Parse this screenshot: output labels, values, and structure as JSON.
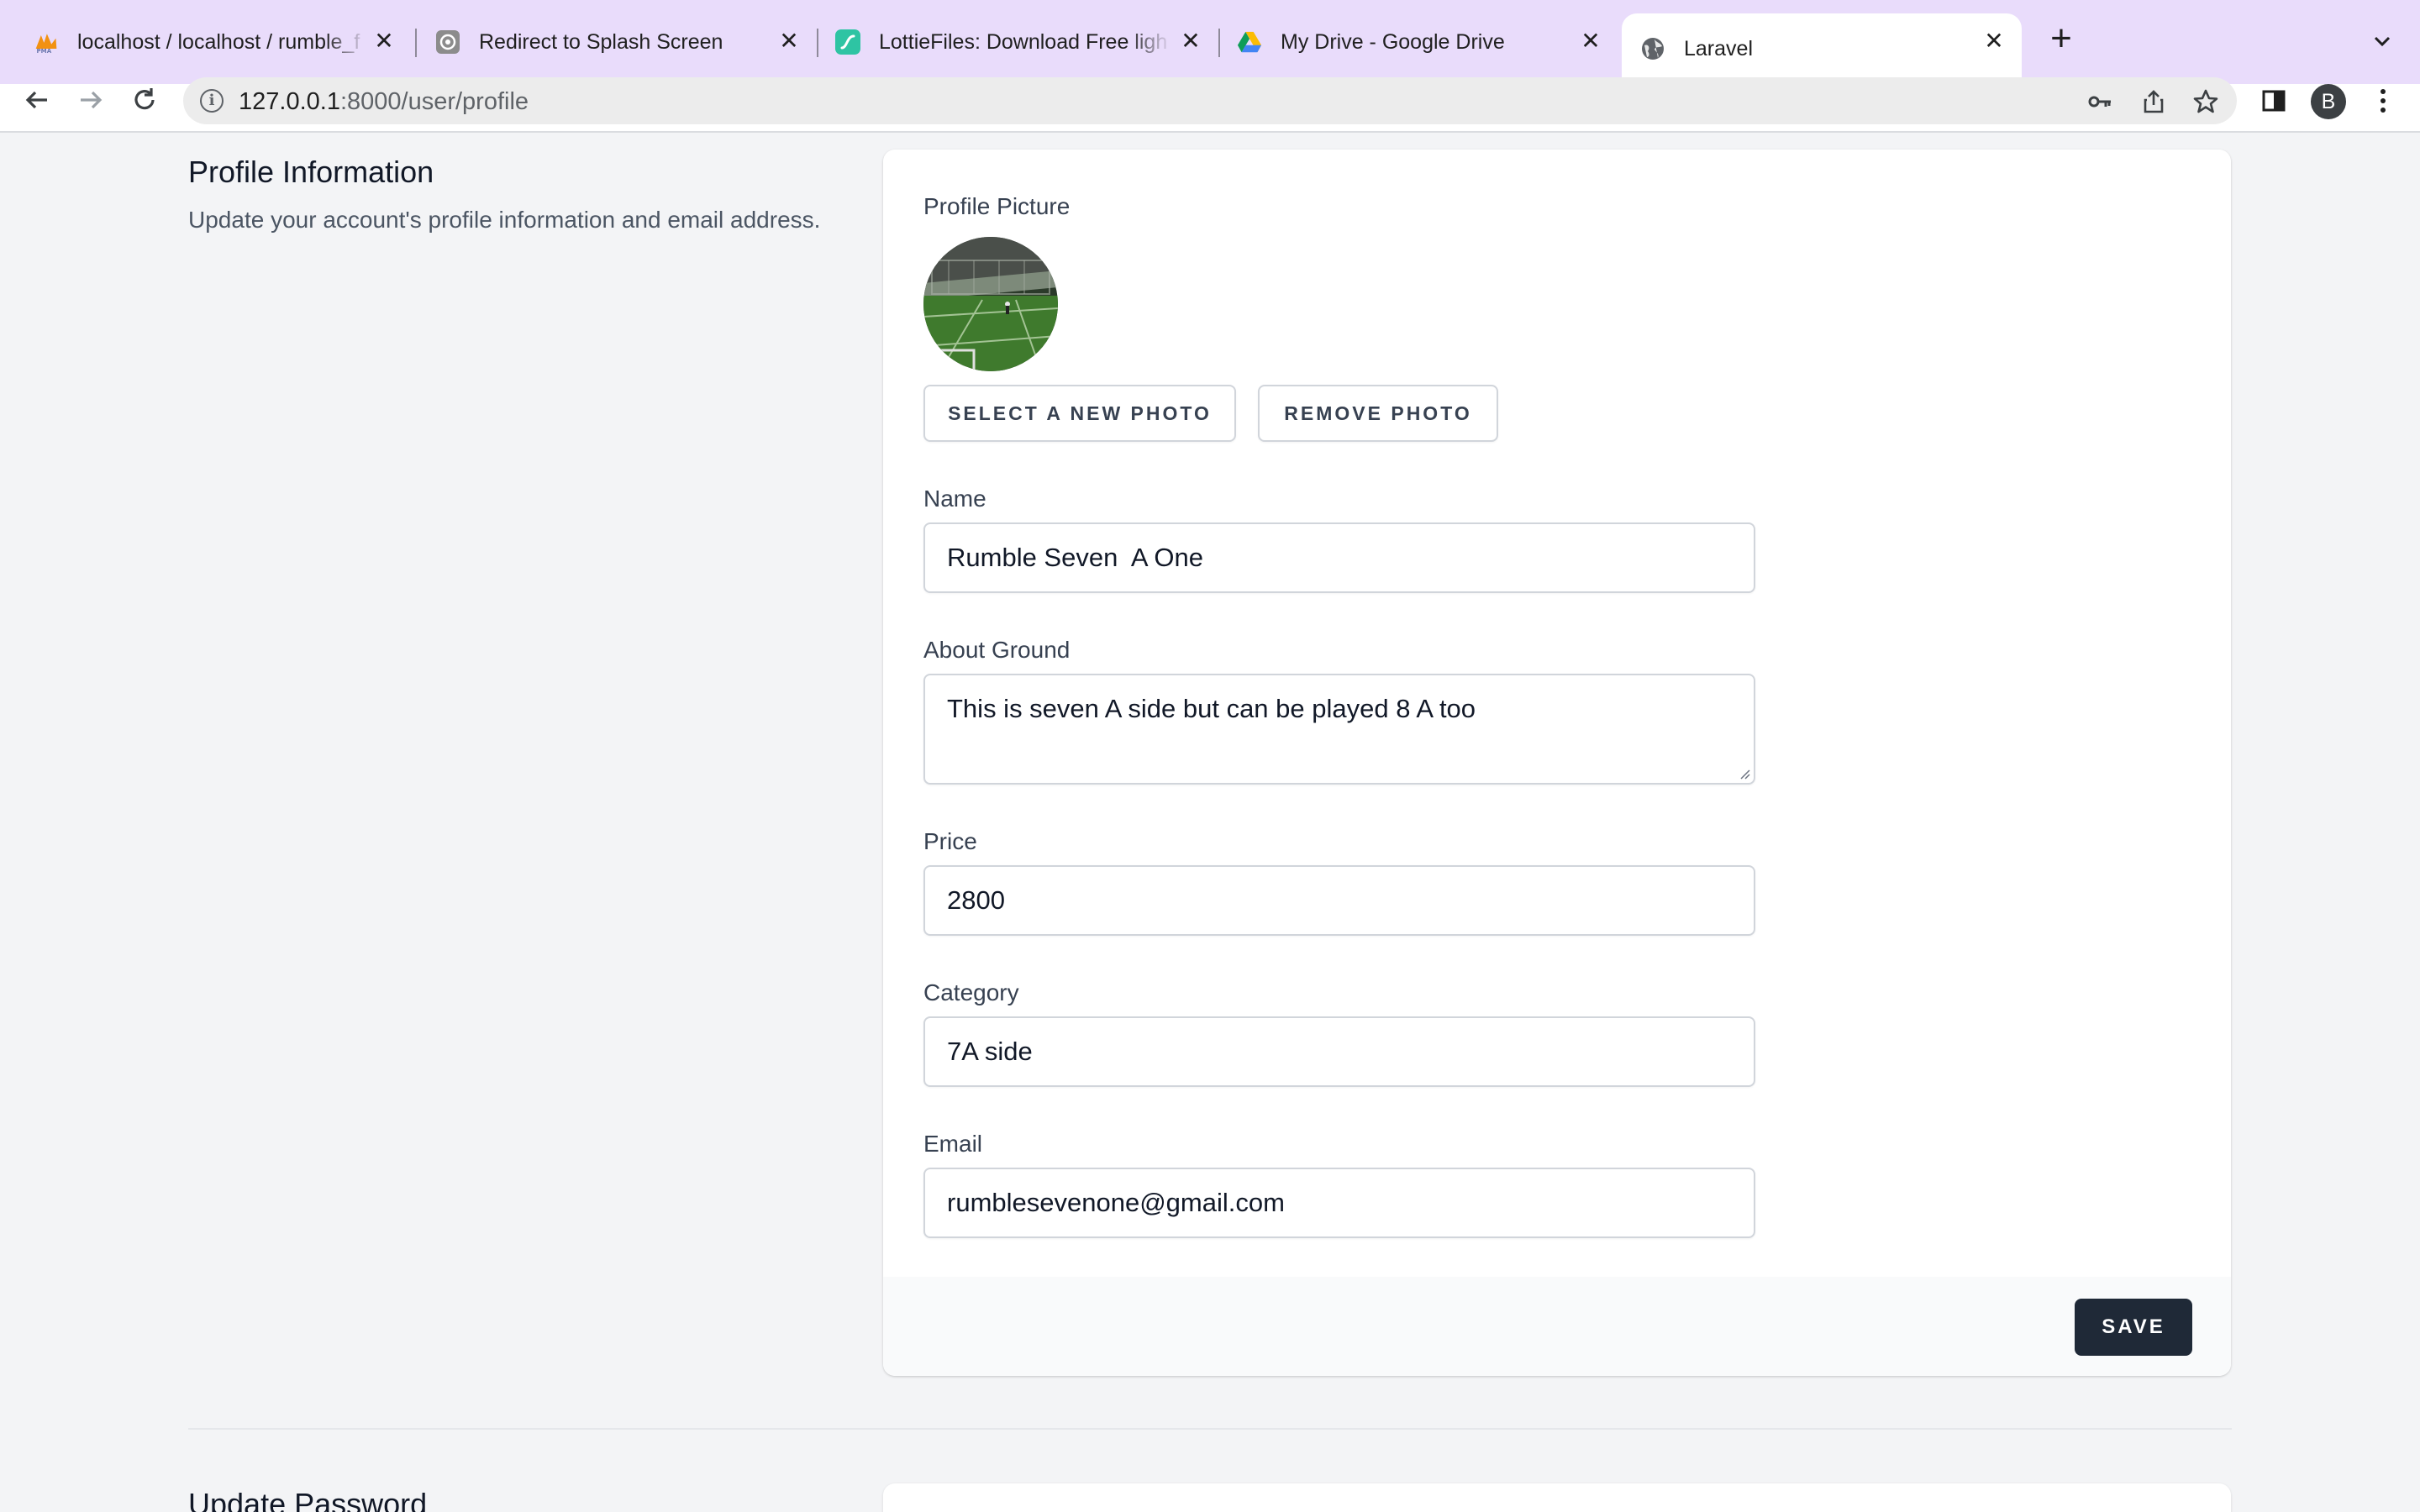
{
  "browser": {
    "tabs": [
      {
        "title": "localhost / localhost / rumble_f",
        "icon": "phpmyadmin-icon"
      },
      {
        "title": "Redirect to Splash Screen",
        "icon": "openai-icon"
      },
      {
        "title": "LottieFiles: Download Free ligh",
        "icon": "lottiefiles-icon"
      },
      {
        "title": "My Drive - Google Drive",
        "icon": "google-drive-icon"
      },
      {
        "title": "Laravel",
        "icon": "globe-icon",
        "active": true
      }
    ],
    "url_host": "127.0.0.1",
    "url_path": ":8000/user/profile",
    "profile_initial": "B"
  },
  "profile": {
    "section_title": "Profile Information",
    "section_description": "Update your account's profile information and email address.",
    "photo_label": "Profile Picture",
    "select_photo_button": "SELECT A NEW PHOTO",
    "remove_photo_button": "REMOVE PHOTO",
    "name_label": "Name",
    "name_value": "Rumble Seven  A One",
    "about_label": "About Ground",
    "about_value": "This is seven A side but can be played 8 A too",
    "price_label": "Price",
    "price_value": "2800",
    "category_label": "Category",
    "category_value": "7A side",
    "email_label": "Email",
    "email_value": "rumblesevenone@gmail.com",
    "save_button": "SAVE"
  },
  "password": {
    "section_title": "Update Password"
  },
  "colors": {
    "tabbar": "#e9dcfb",
    "save_button": "#1f2937",
    "page_bg": "#f3f4f6"
  }
}
